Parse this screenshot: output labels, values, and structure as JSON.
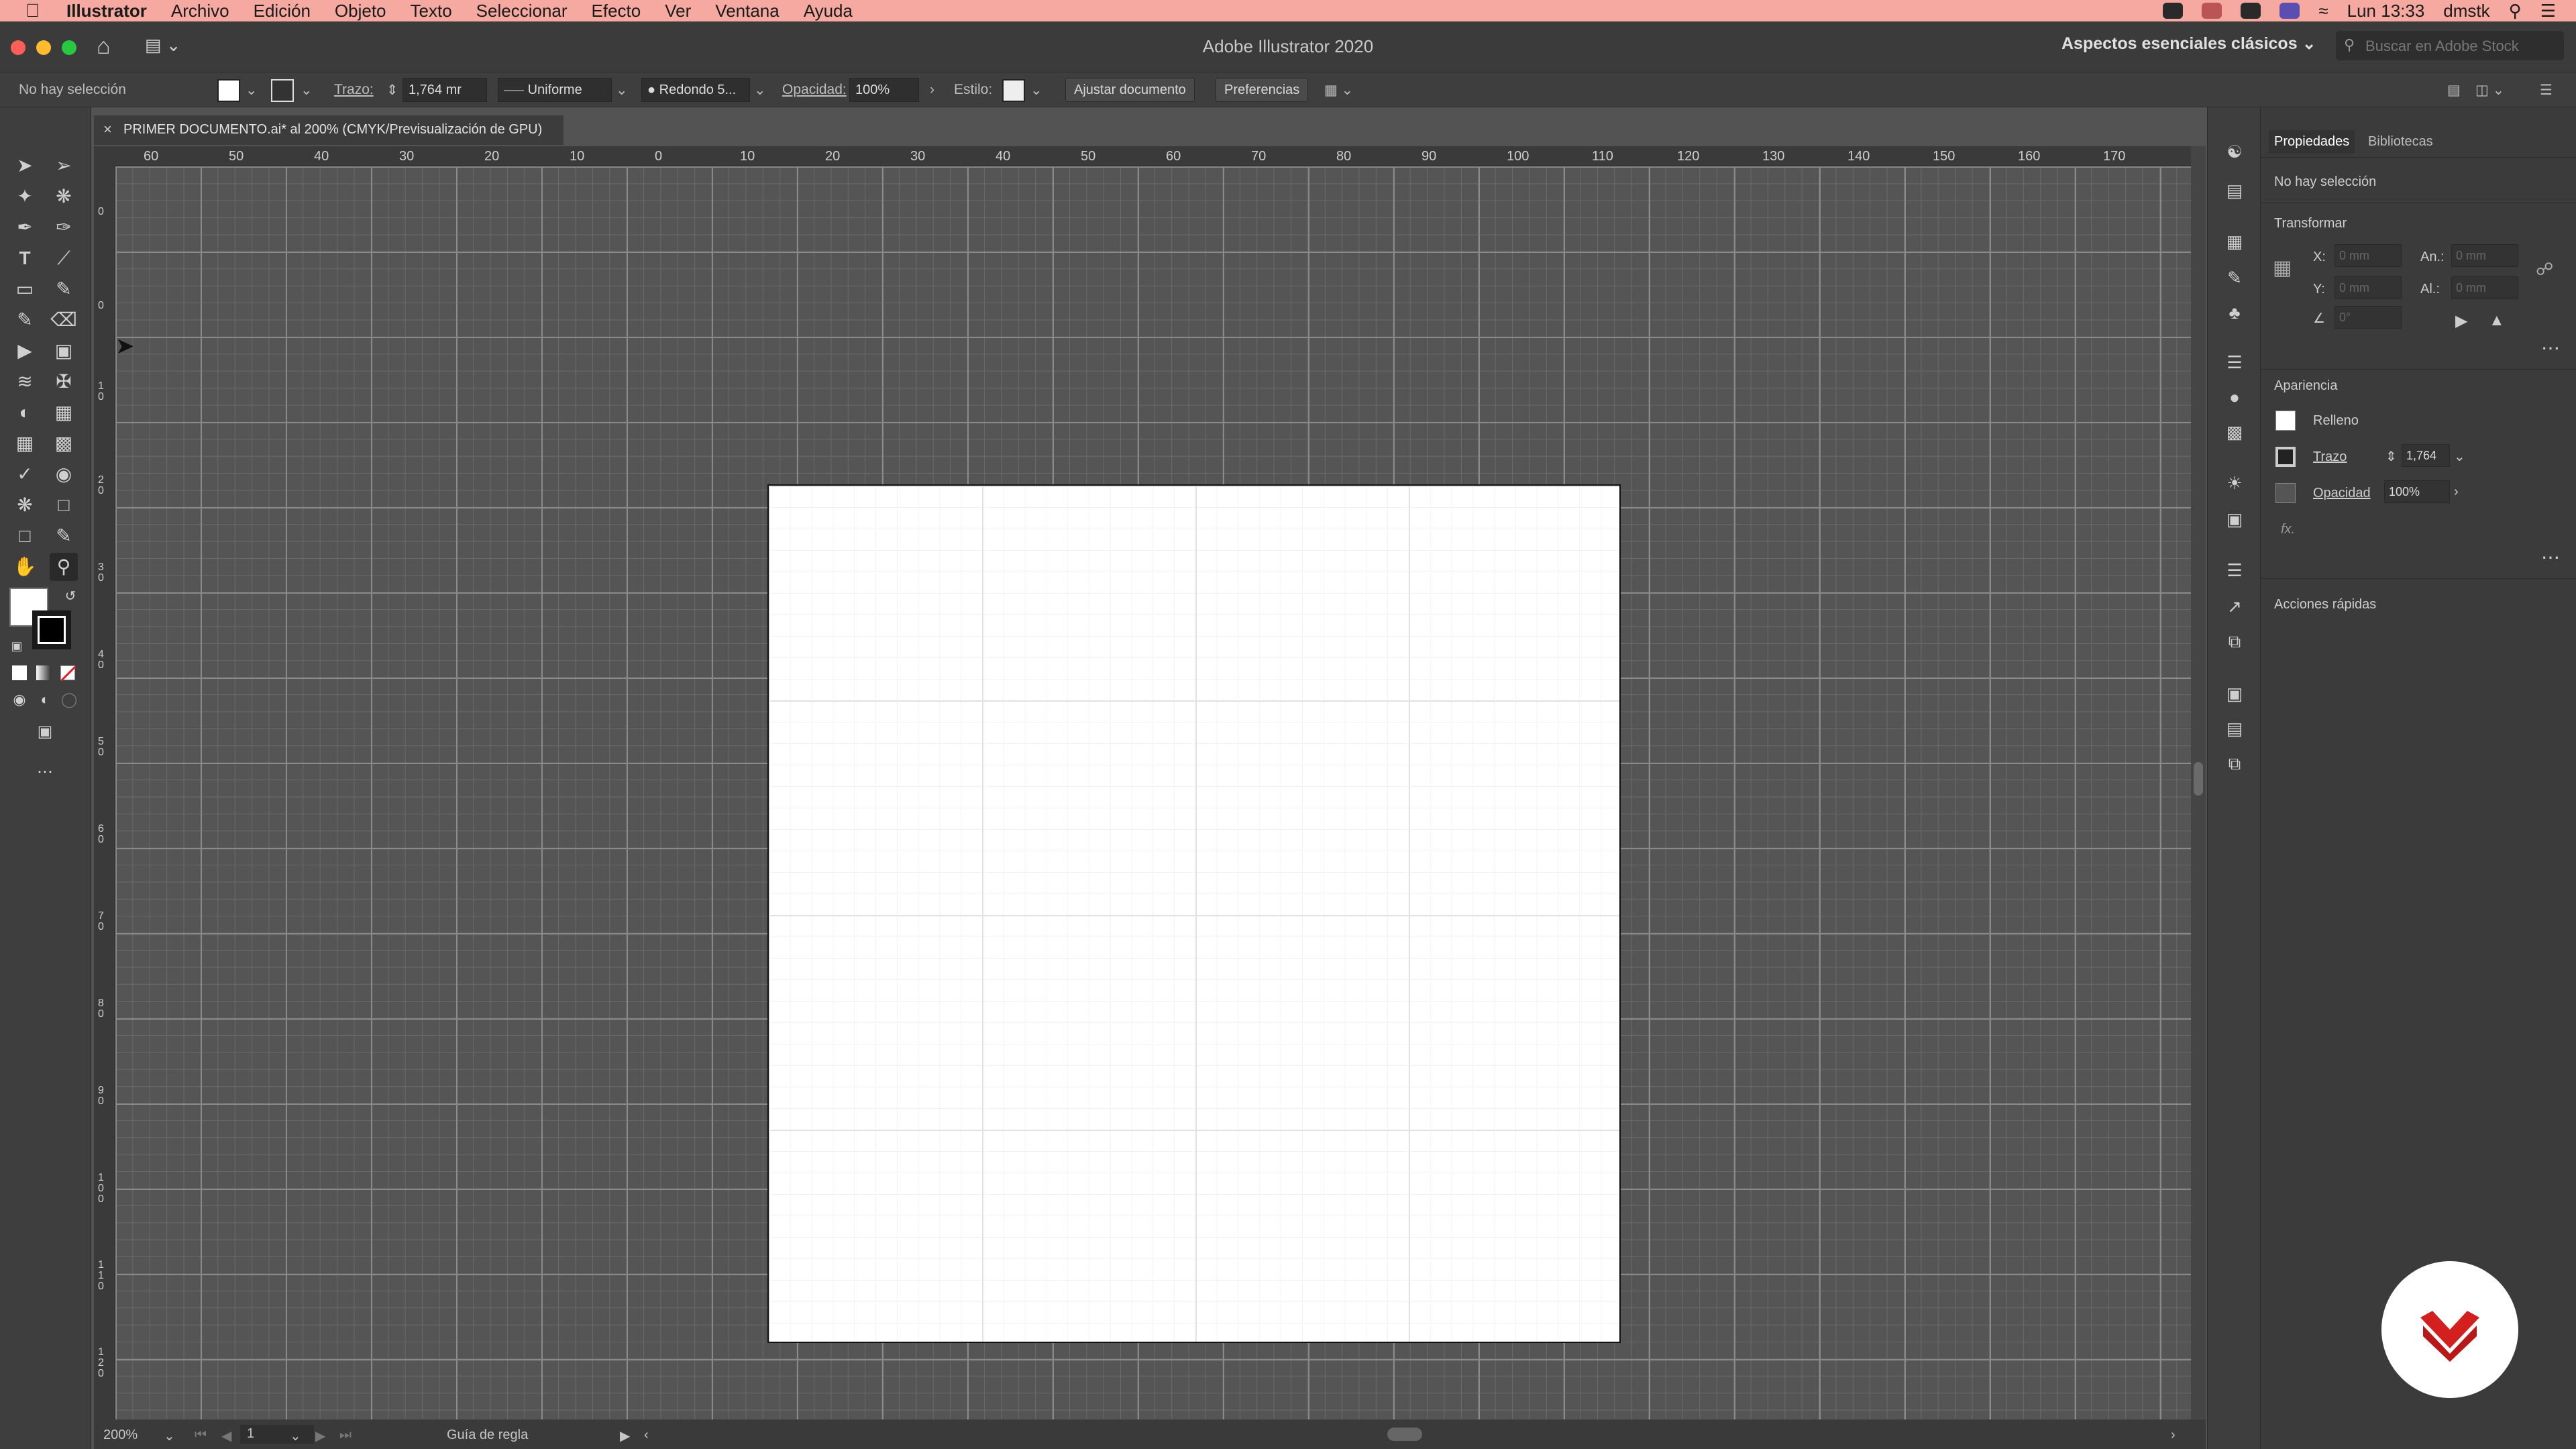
{
  "menubar": {
    "app": "Illustrator",
    "items": [
      "Archivo",
      "Edición",
      "Objeto",
      "Texto",
      "Seleccionar",
      "Efecto",
      "Ver",
      "Ventana",
      "Ayuda"
    ],
    "clock": "Lun 13:33",
    "user": "dmstk"
  },
  "window": {
    "title": "Adobe Illustrator 2020",
    "workspace": "Aspectos esenciales clásicos",
    "search_placeholder": "Buscar en Adobe Stock"
  },
  "control_bar": {
    "selection": "No hay selección",
    "stroke_label": "Trazo:",
    "stroke_value": "1,764 mr",
    "profile": "Uniforme",
    "brush": "Redondo 5...",
    "opacity_label": "Opacidad:",
    "opacity_value": "100%",
    "style_label": "Estilo:",
    "fit_button": "Ajustar documento",
    "prefs_button": "Preferencias"
  },
  "document": {
    "tab_title": "PRIMER DOCUMENTO.ai* al 200% (CMYK/Previsualización de GPU)"
  },
  "ruler": {
    "h_labels": [
      "60",
      "50",
      "40",
      "30",
      "20",
      "10",
      "0",
      "10",
      "20",
      "30",
      "40",
      "50",
      "60",
      "70",
      "80",
      "90",
      "100",
      "110",
      "120",
      "130",
      "140",
      "150",
      "160",
      "170"
    ],
    "v_labels": [
      "0",
      "0",
      "10",
      "20",
      "30",
      "40",
      "50",
      "60",
      "70",
      "80",
      "90",
      "100",
      "110",
      "120"
    ]
  },
  "status_bar": {
    "zoom": "200%",
    "artboard": "1",
    "tool_hint": "Guía de regla"
  },
  "properties": {
    "tabs": [
      "Propiedades",
      "Bibliotecas"
    ],
    "selection": "No hay selección",
    "transform_heading": "Transformar",
    "x_label": "X:",
    "y_label": "Y:",
    "w_label": "An.:",
    "h_label": "Al.:",
    "x_value": "0 mm",
    "y_value": "0 mm",
    "w_value": "0 mm",
    "h_value": "0 mm",
    "angle_value": "0°",
    "appearance_heading": "Apariencia",
    "fill_label": "Relleno",
    "stroke_label": "Trazo",
    "stroke_value": "1,764",
    "opacity_label": "Opacidad",
    "opacity_value": "100%",
    "fx_label": "fx.",
    "quick_actions": "Acciones rápidas"
  },
  "colors": {
    "menubar_bg": "#f5a9a0",
    "canvas_bg": "#555555",
    "artboard": "#ffffff",
    "logo_red": "#d41f1f"
  }
}
